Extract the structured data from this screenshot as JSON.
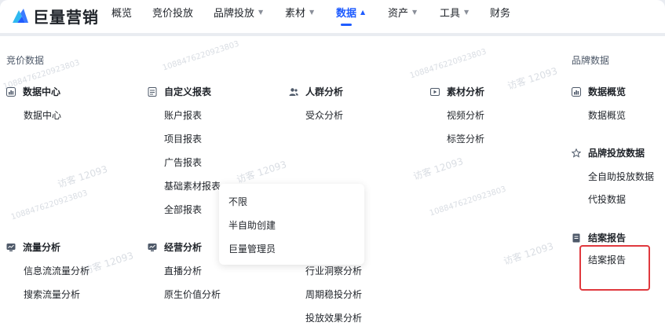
{
  "app": {
    "logo_text": "巨量营销"
  },
  "nav": {
    "items": [
      {
        "label": "概览",
        "caret": ""
      },
      {
        "label": "竞价投放",
        "caret": ""
      },
      {
        "label": "品牌投放",
        "caret": "▼"
      },
      {
        "label": "素材",
        "caret": "▼"
      },
      {
        "label": "数据",
        "caret": "▲"
      },
      {
        "label": "资产",
        "caret": "▼"
      },
      {
        "label": "工具",
        "caret": "▼"
      },
      {
        "label": "财务",
        "caret": ""
      }
    ],
    "active": "数据"
  },
  "sections": {
    "bidding_title": "竞价数据",
    "brand_title": "品牌数据"
  },
  "groups": {
    "data_center": {
      "title": "数据中心",
      "items": [
        "数据中心"
      ]
    },
    "custom_report": {
      "title": "自定义报表",
      "items": [
        "账户报表",
        "项目报表",
        "广告报表",
        "基础素材报表",
        "全部报表"
      ]
    },
    "audience": {
      "title": "人群分析",
      "items": [
        "受众分析"
      ]
    },
    "material": {
      "title": "素材分析",
      "items": [
        "视频分析",
        "标签分析"
      ]
    },
    "traffic": {
      "title": "流量分析",
      "items": [
        "信息流流量分析",
        "搜索流量分析"
      ]
    },
    "operation": {
      "title": "经营分析",
      "items": [
        "直播分析",
        "原生价值分析"
      ]
    },
    "industry": {
      "items": [
        "行业洞察分析",
        "周期稳投分析",
        "投放效果分析"
      ]
    },
    "brand_overview": {
      "title": "数据概览",
      "items": [
        "数据概览"
      ]
    },
    "brand_delivery": {
      "title": "品牌投放数据",
      "items": [
        "全自助投放数据",
        "代投数据"
      ]
    },
    "settlement": {
      "title": "结案报告",
      "items": [
        "结案报告"
      ]
    }
  },
  "dropdown": {
    "options": [
      "不限",
      "半自助创建",
      "巨量管理员"
    ]
  },
  "watermark": {
    "text": "访客 12093",
    "id": "1088476220923803"
  },
  "colors": {
    "accent": "#1f5cff",
    "highlight": "#e0393e",
    "watermark": "#d9dde3"
  }
}
